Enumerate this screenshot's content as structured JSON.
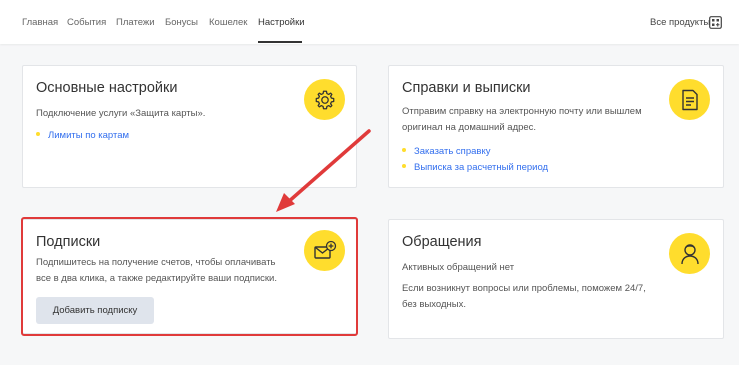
{
  "nav": {
    "tabs": [
      {
        "label": "Главная"
      },
      {
        "label": "События"
      },
      {
        "label": "Платежи"
      },
      {
        "label": "Бонусы"
      },
      {
        "label": "Кошелек"
      },
      {
        "label": "Настройки"
      }
    ],
    "active_tab": "Настройки",
    "all_products": "Все продукты",
    "all_products_icon": "grid-plus-icon"
  },
  "cards": {
    "basic": {
      "title": "Основные настройки",
      "desc": "Подключение услуги «Защита карты».",
      "links": [
        "Лимиты по картам"
      ],
      "icon": "gear-icon"
    },
    "statements": {
      "title": "Справки и выписки",
      "desc_line1": "Отправим справку на электронную почту или вышлем",
      "desc_line2": "оригинал на домашний адрес.",
      "links": [
        "Заказать справку",
        "Выписка за расчетный период"
      ],
      "icon": "document-icon"
    },
    "subscriptions": {
      "title": "Подписки",
      "desc_line1": "Подпишитесь на получение счетов, чтобы оплачивать",
      "desc_line2": "все в два клика, а также редактируйте ваши подписки.",
      "button": "Добавить подписку",
      "icon": "envelope-plus-icon"
    },
    "appeals": {
      "title": "Обращения",
      "status": "Активных обращений нет",
      "desc_line1": "Если возникнут вопросы или проблемы, поможем 24/7,",
      "desc_line2": "без выходных.",
      "icon": "support-agent-icon"
    }
  },
  "colors": {
    "accent_yellow": "#ffdd2d",
    "link_blue": "#336fee",
    "highlight_red": "#e03a3a"
  }
}
